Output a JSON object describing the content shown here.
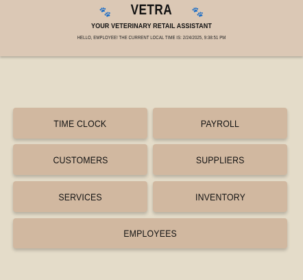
{
  "header": {
    "brand": "VETRA",
    "paw_left_icon": "🐾",
    "paw_right_icon": "🐾",
    "subtitle": "YOUR VETERINARY RETAIL ASSISTANT",
    "greeting": "HELLO, EMPLOYEE! THE CURRENT LOCAL TIME IS: 2/24/2025, 9:38:51 PM"
  },
  "menu": {
    "time_clock": "TIME CLOCK",
    "payroll": "PAYROLL",
    "customers": "CUSTOMERS",
    "suppliers": "SUPPLIERS",
    "services": "SERVICES",
    "inventory": "INVENTORY",
    "employees": "EMPLOYEES"
  },
  "colors": {
    "background": "#e4dcc9",
    "header": "#dbc8b5",
    "button": "#d1b8a0",
    "paw": "#6b4fa3"
  }
}
